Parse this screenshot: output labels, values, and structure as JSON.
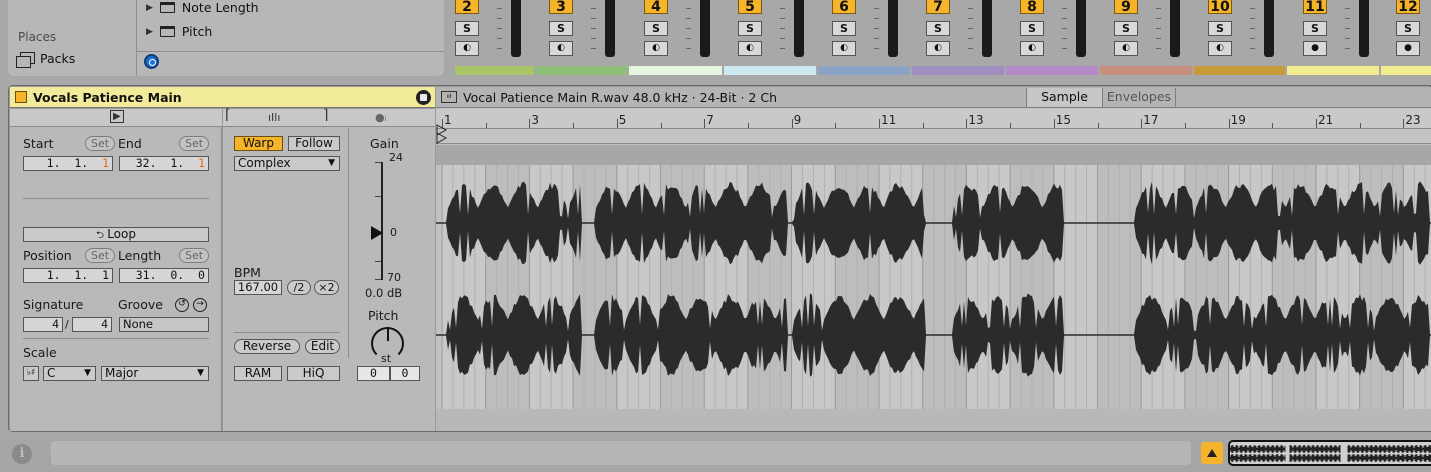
{
  "browser": {
    "places_label": "Places",
    "packs_label": "Packs",
    "tree_items": [
      {
        "label": "Note Length"
      },
      {
        "label": "Pitch"
      }
    ]
  },
  "mixer": {
    "tracks": [
      {
        "num": "2",
        "color": "#a8c56a",
        "solo": "S"
      },
      {
        "num": "3",
        "color": "#8fc07a",
        "solo": "S"
      },
      {
        "num": "4",
        "color": "#e4f5e0",
        "solo": "S"
      },
      {
        "num": "5",
        "color": "#cfe9f1",
        "solo": "S"
      },
      {
        "num": "6",
        "color": "#8aa3c6",
        "solo": "S"
      },
      {
        "num": "7",
        "color": "#9f8fc1",
        "solo": "S"
      },
      {
        "num": "8",
        "color": "#b58ac8",
        "solo": "S"
      },
      {
        "num": "9",
        "color": "#c6907c",
        "solo": "S"
      },
      {
        "num": "10",
        "color": "#c79a3a",
        "solo": "S"
      },
      {
        "num": "11",
        "color": "#f1ec8f",
        "solo": "S"
      },
      {
        "num": "12",
        "color": "#f1ec8f",
        "solo": "S"
      }
    ]
  },
  "clip": {
    "name": "Vocals Patience Main",
    "start_label": "Start",
    "end_label": "End",
    "set_label": "Set",
    "start_value": "1.  1.  ",
    "start_digit": "1",
    "end_value": "32.  1.  ",
    "end_digit": "1",
    "loop_label": "Loop",
    "position_label": "Position",
    "length_label": "Length",
    "position_value": "1.  1.  1",
    "length_value": "31.  0.  0",
    "signature_label": "Signature",
    "groove_label": "Groove",
    "sig_num": "4",
    "sig_den": "4",
    "groove_value": "None",
    "scale_label": "Scale",
    "scale_root": "C",
    "scale_mode": "Major"
  },
  "audio": {
    "warp_label": "Warp",
    "follow_label": "Follow",
    "warp_mode": "Complex",
    "bpm_label": "BPM",
    "bpm_value": "167.00",
    "half_label": "/2",
    "double_label": "×2",
    "reverse_label": "Reverse",
    "edit_label": "Edit",
    "ram_label": "RAM",
    "hiq_label": "HiQ",
    "gain_label": "Gain",
    "gain_top": "24",
    "gain_zero": "0",
    "gain_bottom": "70",
    "gain_value": "0.0 dB",
    "pitch_label": "Pitch",
    "pitch_unit": "st",
    "pitch_value": "0",
    "detune_value": "0"
  },
  "editor": {
    "file_info": "Vocal Patience Main R.wav  48.0 kHz · 24-Bit · 2 Ch",
    "tab_sample": "Sample",
    "tab_envelopes": "Envelopes",
    "bar_numbers": [
      "1",
      "3",
      "5",
      "7",
      "9",
      "11",
      "13",
      "15",
      "17",
      "19",
      "21",
      "23"
    ]
  }
}
